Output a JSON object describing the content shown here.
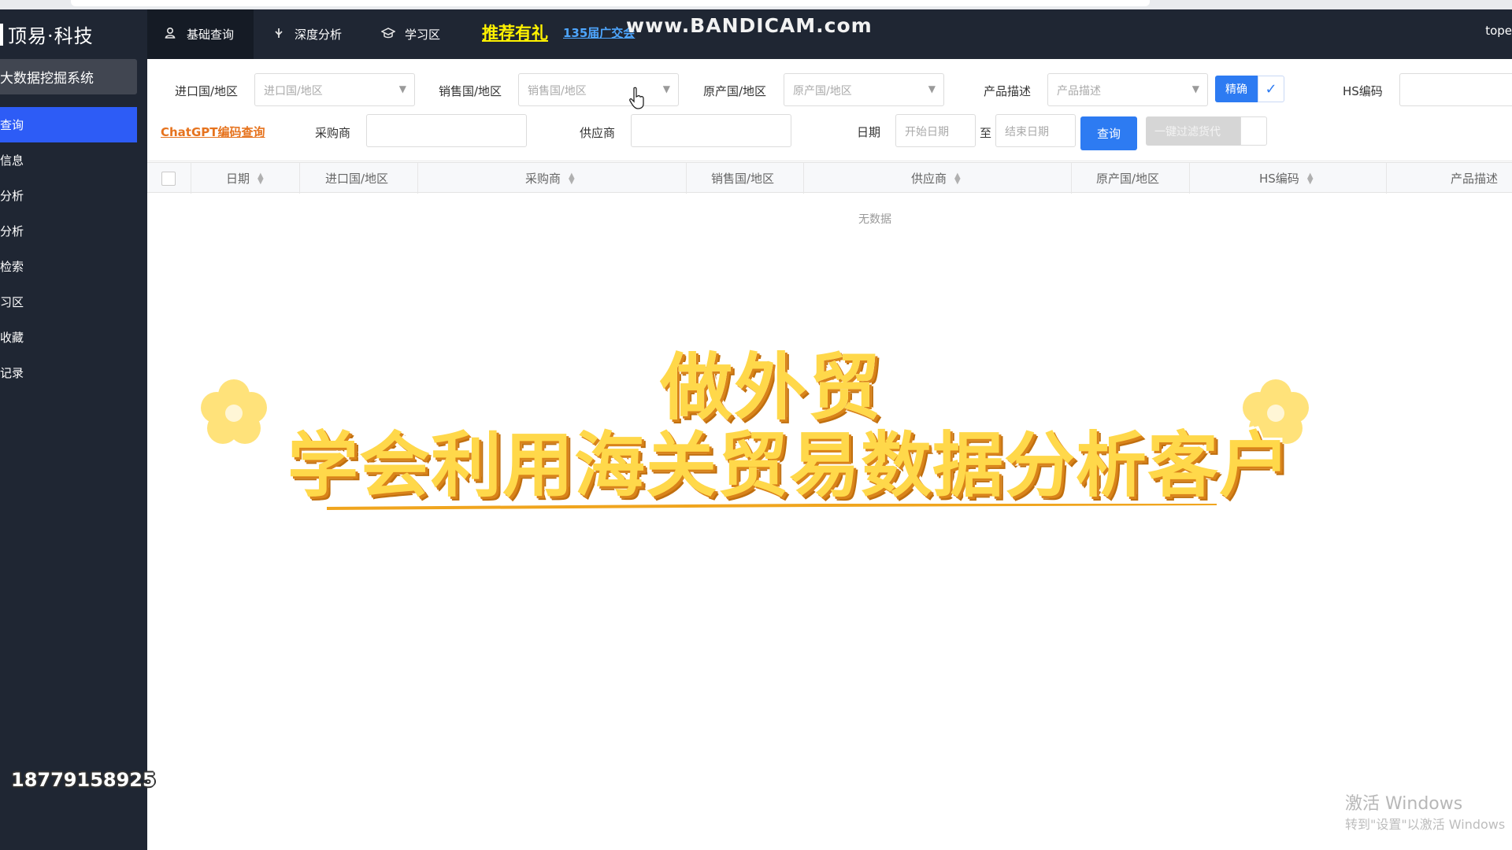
{
  "header": {
    "logo_text": "顶易·科技",
    "nav": [
      {
        "label": "基础查询",
        "icon": "search-user-icon"
      },
      {
        "label": "深度分析",
        "icon": "analysis-icon"
      },
      {
        "label": "学习区",
        "icon": "graduation-cap-icon"
      }
    ],
    "promo_label": "推荐有礼",
    "promo_sub": "135届广交会",
    "recorder_watermark": "www.BANDICAM.com",
    "user_name": "tope"
  },
  "sidebar": {
    "system_title": "大数据挖掘系统",
    "items": [
      {
        "label": "查询"
      },
      {
        "label": "信息"
      },
      {
        "label": "分析"
      },
      {
        "label": "分析"
      },
      {
        "label": "检索"
      },
      {
        "label": "习区"
      },
      {
        "label": "收藏"
      },
      {
        "label": "记录"
      }
    ],
    "phone": "18779158925"
  },
  "filters": {
    "import_country_label": "进口国/地区",
    "import_country_placeholder": "进口国/地区",
    "sales_country_label": "销售国/地区",
    "sales_country_placeholder": "销售国/地区",
    "origin_country_label": "原产国/地区",
    "origin_country_placeholder": "原产国/地区",
    "product_desc_label": "产品描述",
    "product_desc_placeholder": "产品描述",
    "precise_label": "精确",
    "hs_code_label": "HS编码",
    "chatgpt_link": "ChatGPT编码查询",
    "buyer_label": "采购商",
    "supplier_label": "供应商",
    "date_label": "日期",
    "start_date_placeholder": "开始日期",
    "date_separator": "至",
    "end_date_placeholder": "结束日期",
    "query_button": "查询",
    "filter_agent_button": "一键过滤货代"
  },
  "table": {
    "columns": [
      "日期",
      "进口国/地区",
      "采购商",
      "销售国/地区",
      "供应商",
      "原产国/地区",
      "HS编码",
      "产品描述"
    ],
    "empty_text": "无数据"
  },
  "overlay": {
    "line1": "做外贸",
    "line2": "学会利用海关贸易数据分析客户"
  },
  "os_watermark": {
    "title": "激活 Windows",
    "subtitle": "转到\"设置\"以激活 Windows"
  }
}
